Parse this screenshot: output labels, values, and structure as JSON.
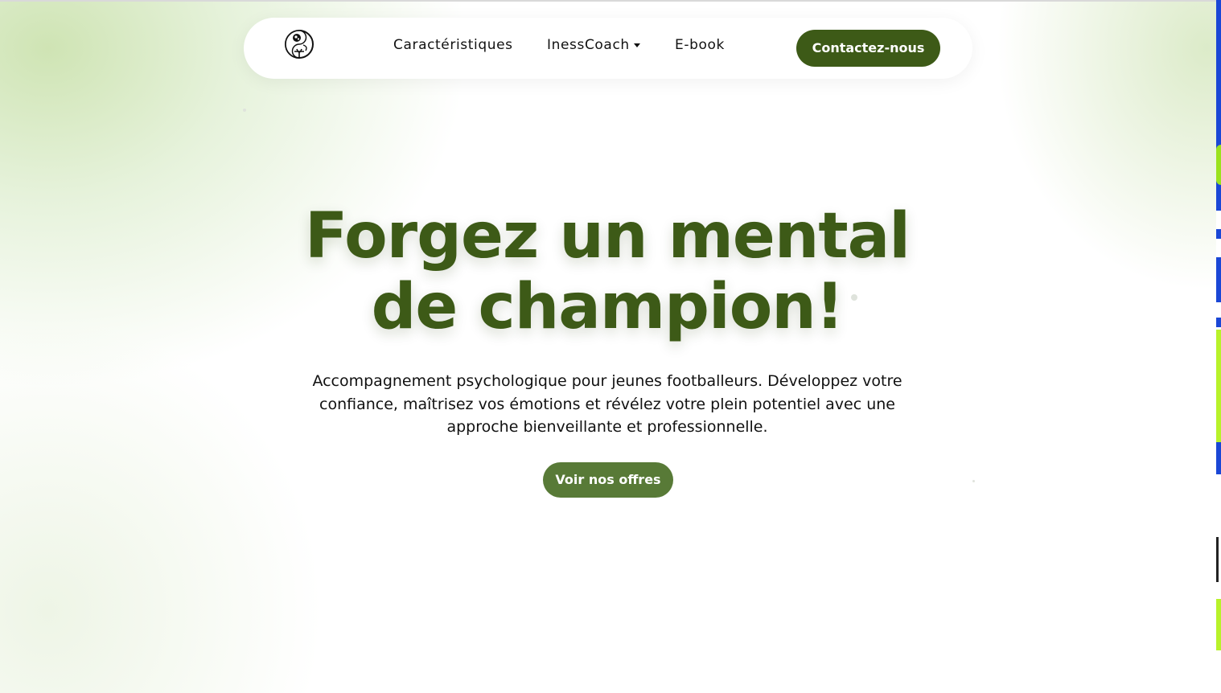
{
  "nav": {
    "logo_icon": "football-yin-yang-logo-icon",
    "links": [
      {
        "label": "Caractéristiques"
      },
      {
        "label": "InessCoach",
        "icon": "caret-down-icon"
      },
      {
        "label": "E-book"
      }
    ],
    "contact_label": "Contactez-nous"
  },
  "hero": {
    "title_line1": "Forgez un mental",
    "title_line2": "de champion!",
    "subtitle": "Accompagnement psychologique pour jeunes footballeurs. Développez votre confiance, maîtrisez vos émotions et révélez votre plein potentiel avec une approche bienveillante et professionnelle.",
    "cta_label": "Voir nos offres"
  },
  "colors": {
    "brand_dark_green": "#3d5a17",
    "button_green": "#587a37",
    "background_light_green": "#cfe4b4"
  }
}
